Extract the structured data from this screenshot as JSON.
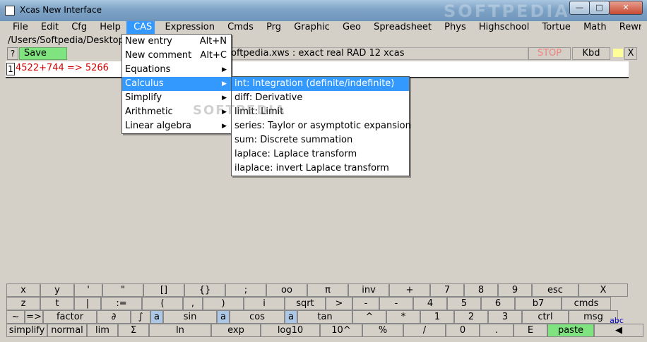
{
  "window": {
    "title": "Xcas New Interface",
    "watermark": "SOFTPEDIA"
  },
  "menubar": [
    "File",
    "Edit",
    "Cfg",
    "Help",
    "CAS",
    "Expression",
    "Cmds",
    "Prg",
    "Graphic",
    "Geo",
    "Spreadsheet",
    "Phys",
    "Highschool",
    "Tortue",
    "Math",
    "Rewrite"
  ],
  "session": {
    "path": "/Users/Softpedia/Desktop",
    "help_label": "?",
    "save_label": "Save",
    "file_info": "oftpedia.xws : exact real RAD 12 xcas",
    "stop_label": "STOP",
    "kbd_label": "Kbd",
    "close_label": "X",
    "line_number": "1",
    "expression": "4522+744 => 5266"
  },
  "cas_menu": {
    "items": [
      {
        "label": "New entry",
        "shortcut": "Alt+N",
        "submenu": ""
      },
      {
        "label": "New comment",
        "shortcut": "Alt+C",
        "submenu": ""
      },
      {
        "label": "Equations",
        "shortcut": "",
        "submenu": "▶"
      },
      {
        "label": "Calculus",
        "shortcut": "",
        "submenu": "▶"
      },
      {
        "label": "Simplify",
        "shortcut": "",
        "submenu": "▶"
      },
      {
        "label": "Arithmetic",
        "shortcut": "",
        "submenu": "▶"
      },
      {
        "label": "Linear algebra",
        "shortcut": "",
        "submenu": "▶"
      }
    ],
    "watermark": "SOFTPEDIA"
  },
  "calculus_menu": {
    "items": [
      "int: Integration (definite/indefinite)",
      "diff: Derivative",
      "limit: Limit",
      "series: Taylor or asymptotic expansion",
      "sum: Discrete summation",
      "laplace: Laplace transform",
      "ilaplace: invert Laplace transform"
    ]
  },
  "keyboard": {
    "rows": [
      [
        "x",
        "y",
        "'",
        "\"",
        "[]",
        "{}",
        ";",
        "oo",
        "π",
        "inv",
        "+",
        "7",
        "8",
        "9",
        "esc",
        "X"
      ],
      [
        "z",
        "t",
        "|",
        ":=",
        "(",
        ",",
        ")",
        "i",
        "sqrt",
        ">",
        "-",
        "-",
        "4",
        "5",
        "6",
        "b7",
        "cmds"
      ],
      [
        "~",
        "=>",
        "factor",
        "∂",
        "∫",
        "a",
        "sin",
        "a",
        "cos",
        "a",
        "tan",
        "^",
        "*",
        "1",
        "2",
        "3",
        "ctrl",
        "msg"
      ],
      [
        "simplify",
        "normal",
        "lim",
        "Σ",
        "ln",
        "exp",
        "log10",
        "10^",
        "%",
        "/",
        "0",
        ".",
        "E",
        "paste",
        "◀"
      ]
    ],
    "row4_extra": "abc"
  }
}
